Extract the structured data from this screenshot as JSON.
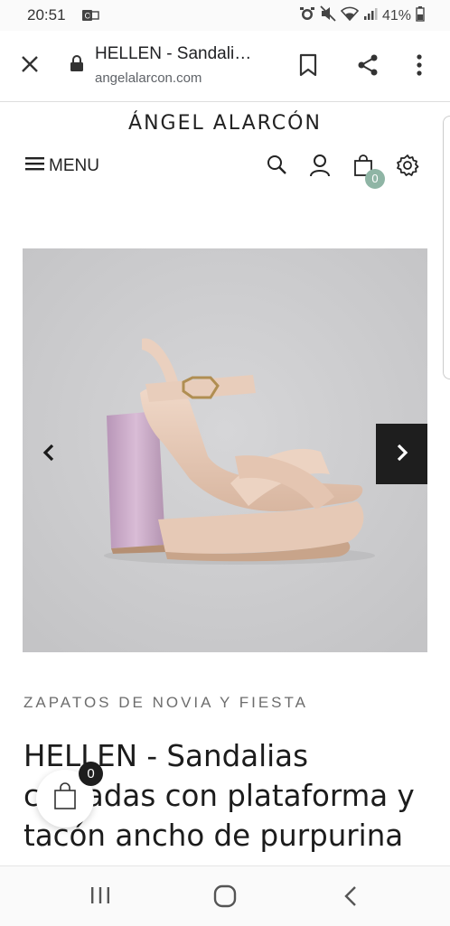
{
  "status_bar": {
    "time": "20:51",
    "battery": "41%",
    "icons": [
      "outlook-icon",
      "alarm-icon",
      "mute-icon",
      "wifi-icon",
      "signal-icon",
      "battery-icon"
    ]
  },
  "browser": {
    "page_title": "HELLEN - Sandali…",
    "url": "angelalarcon.com",
    "icons": [
      "close-icon",
      "lock-icon",
      "bookmark-icon",
      "share-icon",
      "more-icon"
    ]
  },
  "site_header": {
    "brand": "ÁNGEL ALARCÓN",
    "menu_label": "MENU",
    "cart_count": "0",
    "icons": [
      "hamburger-icon",
      "search-icon",
      "user-icon",
      "shopping-bag-icon",
      "settings-icon"
    ]
  },
  "product": {
    "category": "ZAPATOS DE NOVIA Y FIESTA",
    "title": "HELLEN - Sandalias cruzadas con plataforma y tacón ancho de purpurina",
    "image_colors": {
      "background": "#cbcbcd",
      "shoe": "#e6c9b6",
      "heel": "#c8a9c4"
    },
    "carousel_icons": [
      "chevron-left-icon",
      "chevron-right-icon"
    ]
  },
  "floating_cart": {
    "count": "0"
  },
  "nav_bar": {
    "icons": [
      "recent-apps-icon",
      "home-icon",
      "back-icon"
    ]
  }
}
